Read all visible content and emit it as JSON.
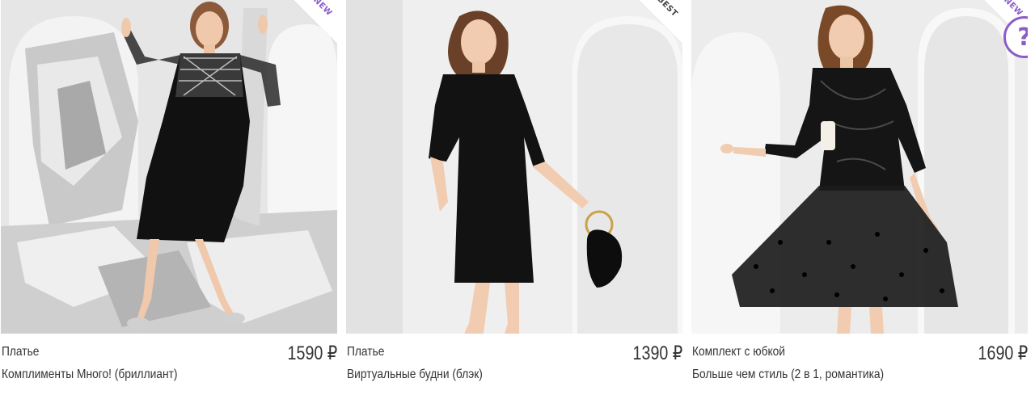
{
  "products": [
    {
      "category": "Платье",
      "name": "Комплименты Много! (бриллиант)",
      "price": "1590 ₽",
      "badge": "NEW",
      "image_desc": "woman-black-dress-silver-foil-background"
    },
    {
      "category": "Платье",
      "name": "Виртуальные будни (блэк)",
      "price": "1390 ₽",
      "badge": "BEST",
      "image_desc": "woman-black-shift-dress-with-handbag"
    },
    {
      "category": "Комплект с юбкой",
      "name": "Больше чем стиль (2 в 1, романтика)",
      "price": "1690 ₽",
      "badge": "NEW",
      "image_desc": "woman-black-lace-top-polka-dot-tulle-skirt"
    }
  ],
  "help_widget": {
    "symbol": "?"
  },
  "colors": {
    "badge_new": "#8b5cc7",
    "dress_black": "#111111",
    "text": "#333333"
  }
}
